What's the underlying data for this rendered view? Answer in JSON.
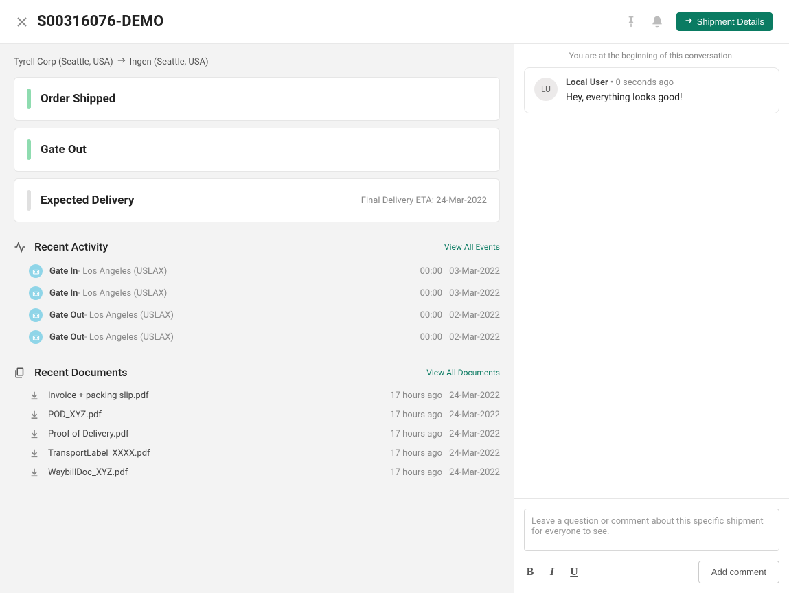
{
  "header": {
    "title": "S00316076-DEMO",
    "shipment_details_label": "Shipment Details"
  },
  "route": {
    "from": "Tyrell Corp (Seattle, USA)",
    "to": "Ingen (Seattle, USA)"
  },
  "status_cards": [
    {
      "title": "Order Shipped",
      "sub": "",
      "color": "green"
    },
    {
      "title": "Gate Out",
      "sub": "",
      "color": "green"
    },
    {
      "title": "Expected Delivery",
      "sub": "Final Delivery ETA: 24-Mar-2022",
      "color": "gray"
    }
  ],
  "recent_activity": {
    "title": "Recent Activity",
    "view_all": "View All Events",
    "items": [
      {
        "name": "Gate In",
        "loc": " - Los Angeles (USLAX)",
        "time": "00:00",
        "date": "03-Mar-2022"
      },
      {
        "name": "Gate In",
        "loc": " - Los Angeles (USLAX)",
        "time": "00:00",
        "date": "03-Mar-2022"
      },
      {
        "name": "Gate Out",
        "loc": " - Los Angeles (USLAX)",
        "time": "00:00",
        "date": "02-Mar-2022"
      },
      {
        "name": "Gate Out",
        "loc": " - Los Angeles (USLAX)",
        "time": "00:00",
        "date": "02-Mar-2022"
      }
    ]
  },
  "recent_documents": {
    "title": "Recent Documents",
    "view_all": "View All Documents",
    "items": [
      {
        "name": "Invoice + packing slip.pdf",
        "ago": "17 hours ago",
        "date": "24-Mar-2022"
      },
      {
        "name": "POD_XYZ.pdf",
        "ago": "17 hours ago",
        "date": "24-Mar-2022"
      },
      {
        "name": "Proof of Delivery.pdf",
        "ago": "17 hours ago",
        "date": "24-Mar-2022"
      },
      {
        "name": "TransportLabel_XXXX.pdf",
        "ago": "17 hours ago",
        "date": "24-Mar-2022"
      },
      {
        "name": "WaybillDoc_XYZ.pdf",
        "ago": "17 hours ago",
        "date": "24-Mar-2022"
      }
    ]
  },
  "conversation": {
    "intro": "You are at the beginning of this conversation.",
    "messages": [
      {
        "initials": "LU",
        "author": "Local User",
        "time": "0 seconds ago",
        "body": "Hey, everything looks good!"
      }
    ],
    "composer": {
      "placeholder": "Leave a question or comment about this specific shipment for everyone to see.",
      "add_label": "Add comment",
      "bold": "B",
      "italic": "I",
      "underline": "U"
    }
  }
}
